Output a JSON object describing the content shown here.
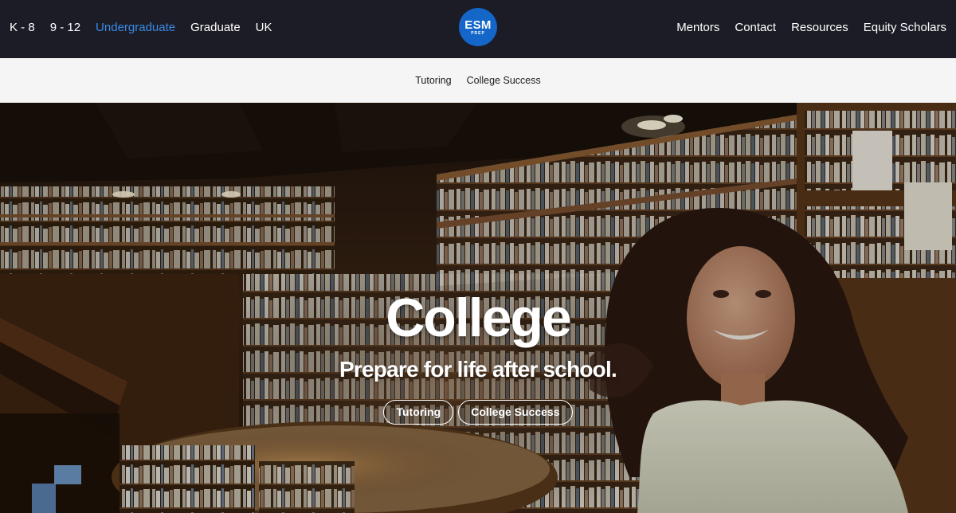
{
  "nav": {
    "left": [
      {
        "label": "K - 8",
        "active": false
      },
      {
        "label": "9 - 12",
        "active": false
      },
      {
        "label": "Undergraduate",
        "active": true
      },
      {
        "label": "Graduate",
        "active": false
      },
      {
        "label": "UK",
        "active": false
      }
    ],
    "logo": {
      "main": "ESM",
      "sub": "PREP",
      "icon": "esm-prep-logo",
      "color": "#1466c8"
    },
    "right": [
      {
        "label": "Mentors"
      },
      {
        "label": "Contact"
      },
      {
        "label": "Resources"
      },
      {
        "label": "Equity Scholars"
      }
    ],
    "background": "#1c1c27",
    "active_color": "#3b8be4"
  },
  "subnav": {
    "items": [
      {
        "label": "Tutoring"
      },
      {
        "label": "College Success"
      }
    ],
    "background": "#f5f5f5"
  },
  "hero": {
    "title": "College",
    "subtitle": "Prepare for life after school.",
    "buttons": [
      {
        "label": "Tutoring"
      },
      {
        "label": "College Success"
      }
    ]
  }
}
